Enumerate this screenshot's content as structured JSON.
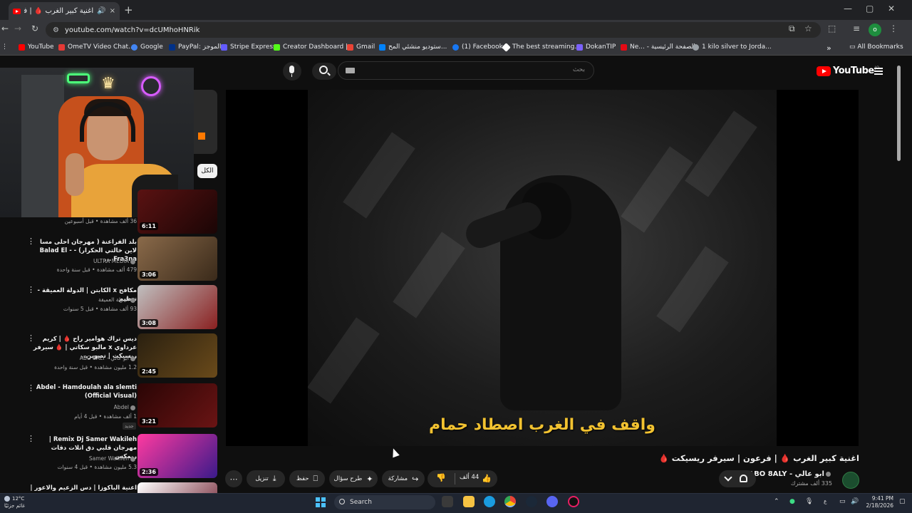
{
  "browser": {
    "tab_title": "اغنية كبير الغرب 🩸 | فرد (78)",
    "new_tab": "+",
    "tab_close": "×",
    "url": "youtube.com/watch?v=dcUMhoHNRik",
    "profile_initial": "o",
    "window_controls": {
      "minimize": "—",
      "maximize": "▢",
      "close": "✕"
    },
    "bookmarks": [
      {
        "label": "YouTube",
        "color": "#ff0000"
      },
      {
        "label": "OmeTV Video Chat...",
        "color": "#e53935"
      },
      {
        "label": "Google",
        "color": "#4285f4"
      },
      {
        "label": "PayPal: الموجز",
        "color": "#003087"
      },
      {
        "label": "Stripe Express",
        "color": "#635bff"
      },
      {
        "label": "Creator Dashboard |...",
        "color": "#53fc18"
      },
      {
        "label": "Gmail",
        "color": "#ea4335"
      },
      {
        "label": "ستوديو منشئي المح...",
        "color": "#0081fb"
      },
      {
        "label": "(1) Facebook",
        "color": "#1877f2"
      },
      {
        "label": "The best streaming...",
        "color": "#ffffff"
      },
      {
        "label": "DokanTIP",
        "color": "#7b61ff"
      },
      {
        "label": "Ne... - الصفحة الرئيسية",
        "color": "#e50914"
      },
      {
        "label": "1 kilo silver to Jorda...",
        "color": "#9aa0a6"
      }
    ],
    "all_bookmarks": "All Bookmarks"
  },
  "youtube": {
    "search_placeholder": "بحث",
    "logo_text": "YouTube",
    "logo_country": "JO",
    "filter_chip_all": "الكل"
  },
  "recommendations": [
    {
      "title": "",
      "channel": "",
      "meta": "36 ألف مشاهدة • قبل أسبوعين",
      "duration": "6:11",
      "thumb_color": "#5a1212"
    },
    {
      "title": "بلد الفراعنة ( مهرجان احلى مسا لاين خالتي الحكرار) - - Balad El Fra3na ...",
      "channel": "ULTRA MEDIA",
      "meta": "479 ألف مشاهدة • قبل سنة واحدة",
      "duration": "3:06",
      "thumb_color": "#7a5a3a"
    },
    {
      "title": "مكافح x الكابتن | الدولة العميقة - تنظيم",
      "channel": "الدولة العميقة",
      "meta": "93 ألف مشاهدة • قبل 5 سنوات",
      "duration": "3:08",
      "thumb_color": "#8a2020"
    },
    {
      "title": "ديس تراك هوامير راح 🩸 | كريم عرداوي x مالبو سكاتي | 🩸 سيرفر ريسيكت | تصوير...",
      "channel": "ابو عالي - ABO 8ALY",
      "meta": "1.2 مليون مشاهدة • قبل سنة واحدة",
      "duration": "2:45",
      "thumb_color": "#3a2a10"
    },
    {
      "title": "Abdel - Hamdoulah ala slemti (Official Visual)",
      "channel": "Abdel",
      "meta": "1 ألف مشاهدة • قبل 4 أيام",
      "duration": "3:21",
      "thumb_color": "#4a0e0e",
      "badge": "جديد"
    },
    {
      "title": "Remix Dj Samer Wakileh | مهرجان قلبي دق اتلات دقات ريمكس",
      "channel": "Samer Wakileh",
      "meta": "5.3 مليون مشاهدة • قبل 4 سنوات",
      "duration": "2:36",
      "thumb_color": "#5a2a8a"
    },
    {
      "title": "اعنية الباكوزا | دس الزعيم والاعور |",
      "channel": "",
      "meta": "",
      "duration": "",
      "thumb_color": "#6a1a2a"
    }
  ],
  "player": {
    "subtitle": "واقف في الغرب اصطاد حمام"
  },
  "video": {
    "title": "اغنية كبير الغرب 🩸 | فرعون | سيرفر ريسيكت 🩸",
    "channel_name": "ابو عالي - ABO 8ALY",
    "subscribers": "335 ألف مشترك",
    "likes": "44 ألف",
    "share_label": "مشاركة",
    "ask_label": "طرح سؤال",
    "save_label": "حفظ",
    "download_label": "تنزيل"
  },
  "taskbar": {
    "temperature": "12°C",
    "weather_text": "غائم جزئيًا",
    "search_label": "Search",
    "language": "ع",
    "time": "9:41 PM",
    "date": "2/18/2026"
  }
}
